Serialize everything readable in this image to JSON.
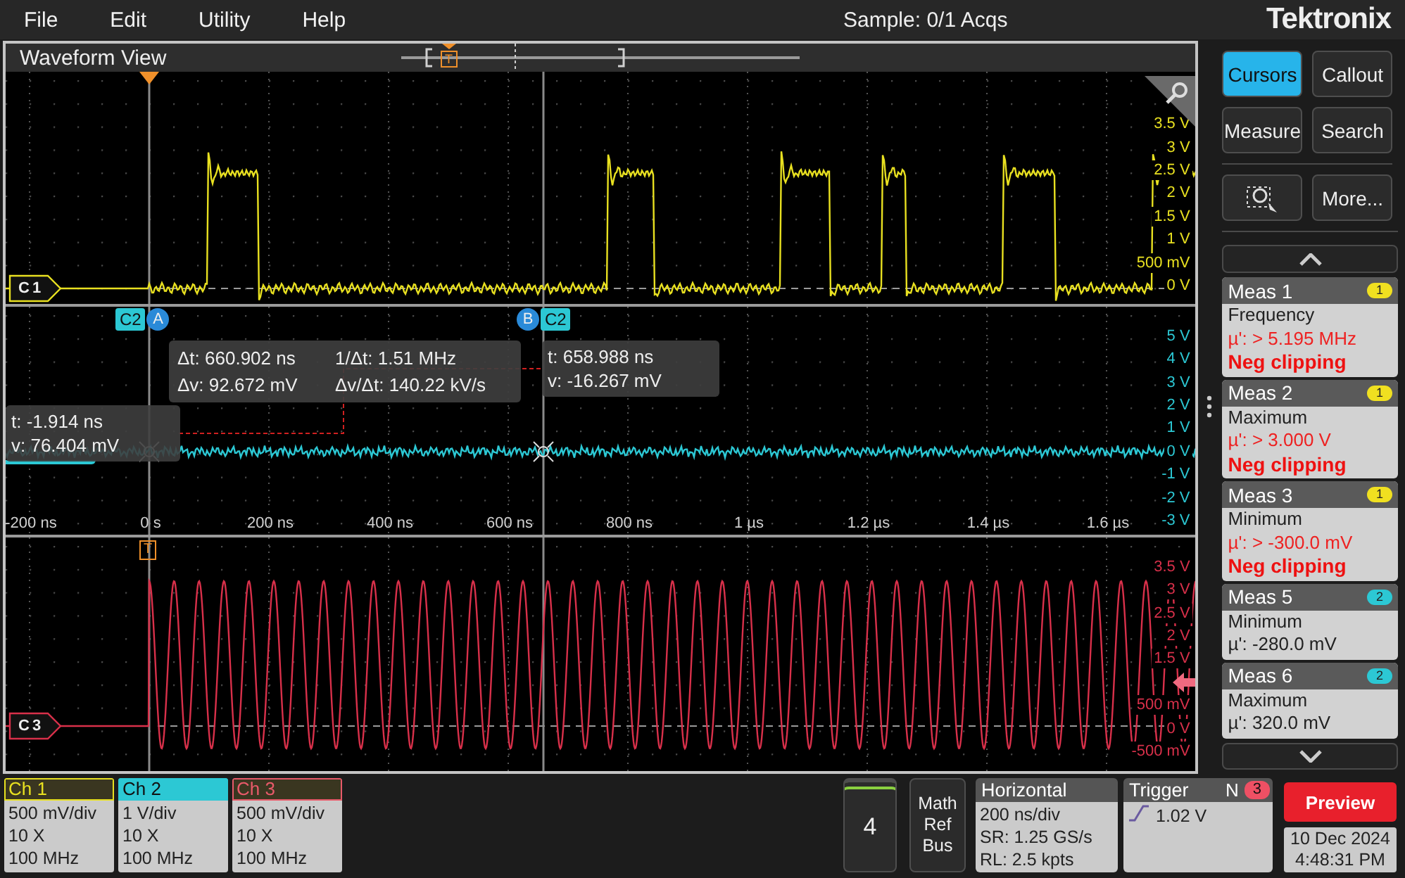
{
  "menu": [
    {
      "label": "File"
    },
    {
      "label": "Edit"
    },
    {
      "label": "Utility"
    },
    {
      "label": "Help"
    }
  ],
  "acquisition_status": "Sample: 0/1 Acqs",
  "brand": "Tektronix",
  "waveform_view": {
    "title": "Waveform View",
    "overview_trigger": "T",
    "panes": [
      {
        "kind": "pulse",
        "channel": "C1",
        "color": "#e8e020",
        "scale": [
          {
            "kind": "label",
            "text": "3.5 V"
          },
          {
            "kind": "label",
            "text": "3 V"
          },
          {
            "kind": "label",
            "text": "2.5 V"
          },
          {
            "kind": "label",
            "text": "2 V"
          },
          {
            "kind": "label",
            "text": "1.5 V"
          },
          {
            "kind": "label",
            "text": "1 V"
          },
          {
            "kind": "label",
            "text": "500 mV"
          },
          {
            "kind": "label",
            "text": "0 V"
          }
        ]
      },
      {
        "kind": "noise",
        "color": "#2cc8d4",
        "scale": [
          {
            "kind": "label",
            "text": "5 V"
          },
          {
            "kind": "label",
            "text": "4 V"
          },
          {
            "kind": "label",
            "text": "3 V"
          },
          {
            "kind": "label",
            "text": "2 V"
          },
          {
            "kind": "label",
            "text": "1 V"
          },
          {
            "kind": "label",
            "text": "0 V"
          },
          {
            "kind": "label",
            "text": "-1 V"
          },
          {
            "kind": "label",
            "text": "-2 V"
          },
          {
            "kind": "label",
            "text": "-3 V"
          }
        ],
        "time_axis": [
          "-200 ns",
          "0 s",
          "200 ns",
          "400 ns",
          "600 ns",
          "800 ns",
          "1 µs",
          "1.2 µs",
          "1.4 µs",
          "1.6 µs"
        ]
      },
      {
        "kind": "sine",
        "channel": "C3",
        "color": "#d8304a",
        "trigger_label": "T",
        "scale": [
          {
            "kind": "label",
            "text": "3.5 V"
          },
          {
            "kind": "label",
            "text": "3 V"
          },
          {
            "kind": "label",
            "text": "2.5 V"
          },
          {
            "kind": "label",
            "text": "2 V"
          },
          {
            "kind": "label",
            "text": "1.5 V"
          },
          {
            "kind": "arrow"
          },
          {
            "kind": "label",
            "text": "500 mV"
          },
          {
            "kind": "label",
            "text": "0 V"
          },
          {
            "kind": "label",
            "text": "-500 mV"
          }
        ]
      }
    ],
    "cursors": [
      {
        "label": "A",
        "source": "C2",
        "readout": [
          "t: -1.914 ns",
          "v: 76.404 mV"
        ]
      },
      {
        "label": "B",
        "source": "C2",
        "readout": [
          "t: 658.988 ns",
          "v: -16.267 mV"
        ]
      }
    ],
    "delta_readout": [
      "Δt: 660.902 ns",
      "1/Δt: 1.51 MHz",
      "Δv: 92.672 mV",
      "Δv/Δt: 140.22 kV/s"
    ]
  },
  "side_panel": {
    "buttons": [
      {
        "kind": "text",
        "label": "Cursors",
        "selected": true
      },
      {
        "kind": "text",
        "label": "Callout",
        "selected": false
      },
      {
        "kind": "text",
        "label": "Measure",
        "selected": false
      },
      {
        "kind": "text",
        "label": "Search",
        "selected": false
      },
      {
        "kind": "icon",
        "selected": false
      },
      {
        "kind": "text",
        "label": "More...",
        "selected": false
      }
    ],
    "measurements": [
      {
        "title": "Meas 1",
        "source": "1",
        "color": "#f0e020",
        "type": "Frequency",
        "value": "µ': > 5.195 MHz",
        "warning": "Neg clipping"
      },
      {
        "title": "Meas 2",
        "source": "1",
        "color": "#f0e020",
        "type": "Maximum",
        "value": "µ': > 3.000 V",
        "warning": "Neg clipping"
      },
      {
        "title": "Meas 3",
        "source": "1",
        "color": "#f0e020",
        "type": "Minimum",
        "value": "µ': > -300.0 mV",
        "warning": "Neg clipping"
      },
      {
        "title": "Meas 5",
        "source": "2",
        "color": "#2cc8d4",
        "type": "Minimum",
        "value": "µ': -280.0 mV"
      },
      {
        "title": "Meas 6",
        "source": "2",
        "color": "#2cc8d4",
        "type": "Maximum",
        "value": "µ': 320.0 mV"
      }
    ]
  },
  "bottom_bar": {
    "channels": [
      {
        "name": "Ch 1",
        "color": "#e8e020",
        "selected": false,
        "settings": [
          "500 mV/div",
          "10 X",
          "100 MHz"
        ]
      },
      {
        "name": "Ch 2",
        "color": "#2cc8d4",
        "selected": true,
        "settings": [
          "1 V/div",
          "10 X",
          "100 MHz"
        ]
      },
      {
        "name": "Ch 3",
        "color": "#e85a6a",
        "selected": false,
        "settings": [
          "500 mV/div",
          "10 X",
          "100 MHz"
        ]
      }
    ],
    "add_channel": "4",
    "math_ref_bus": "Math Ref Bus",
    "horizontal": {
      "title": "Horizontal",
      "lines": [
        "200 ns/div",
        "SR: 1.25 GS/s",
        "RL: 2.5 kpts"
      ]
    },
    "trigger": {
      "title": "Trigger",
      "mode": "N",
      "source": "3",
      "level": "1.02 V"
    },
    "preview": "Preview",
    "date": "10 Dec 2024",
    "time": "4:48:31 PM"
  }
}
